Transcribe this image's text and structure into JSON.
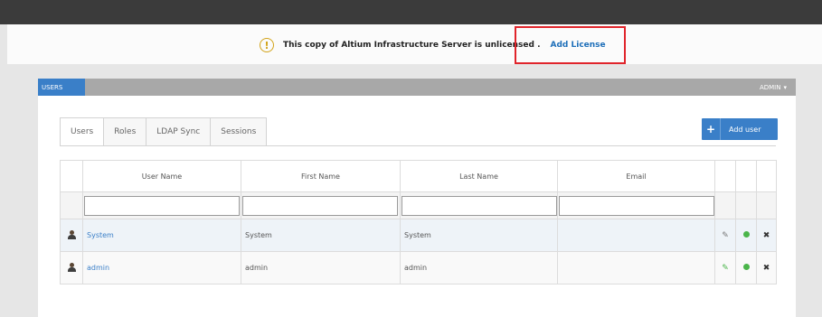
{
  "notice": {
    "warning_icon": "exclamation-circle-icon",
    "icon_glyph": "!",
    "text": "This copy of Altium Infrastructure Server is unlicensed .",
    "link_label": "Add License"
  },
  "app_bar": {
    "section_label": "USERS",
    "user_menu_label": "ADMIN",
    "user_menu_caret": "▾"
  },
  "tabs": [
    "Users",
    "Roles",
    "LDAP Sync",
    "Sessions"
  ],
  "add_user": {
    "icon": "plus-icon",
    "glyph": "+",
    "label": "Add user"
  },
  "table": {
    "columns": [
      "User Name",
      "First Name",
      "Last Name",
      "Email"
    ],
    "rows": [
      {
        "user_name": "System",
        "first_name": "System",
        "last_name": "System",
        "email": "",
        "pencil_color": "#777777"
      },
      {
        "user_name": "admin",
        "first_name": "admin",
        "last_name": "admin",
        "email": "",
        "pencil_color": "#4ab54a"
      }
    ],
    "edit_glyph": "✎",
    "delete_glyph": "✖"
  },
  "colors": {
    "accent": "#3a7fc8",
    "highlight_box": "#e0242b",
    "status_green": "#4ab54a",
    "warning": "#d2a319"
  }
}
